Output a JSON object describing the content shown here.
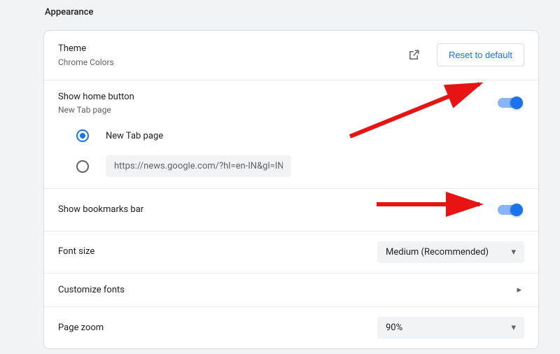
{
  "section": {
    "title": "Appearance"
  },
  "theme": {
    "title": "Theme",
    "sub": "Chrome Colors",
    "reset_label": "Reset to default"
  },
  "home_button": {
    "title": "Show home button",
    "sub": "New Tab page",
    "options": {
      "new_tab": "New Tab page",
      "custom_url": "https://news.google.com/?hl=en-IN&gl=IN&c…"
    }
  },
  "bookmarks_bar": {
    "title": "Show bookmarks bar"
  },
  "font_size": {
    "title": "Font size",
    "value": "Medium (Recommended)"
  },
  "customize_fonts": {
    "title": "Customize fonts"
  },
  "page_zoom": {
    "title": "Page zoom",
    "value": "90%"
  }
}
